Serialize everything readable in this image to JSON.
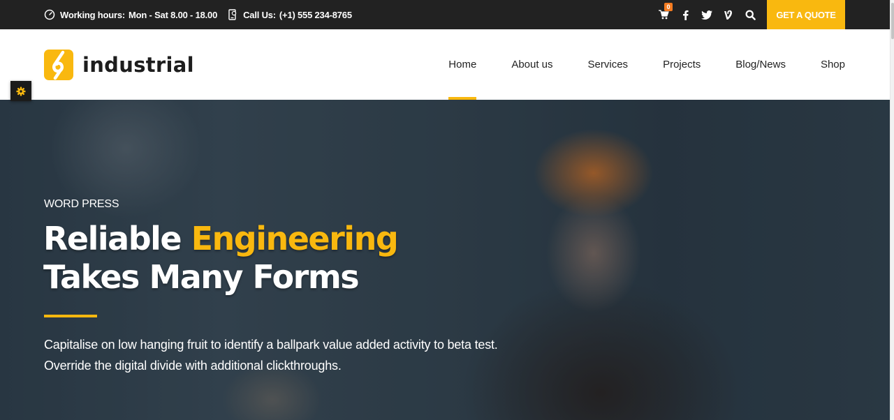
{
  "topbar": {
    "working_hours_label": "Working hours:",
    "working_hours_value": "Mon - Sat 8.00 - 18.00",
    "call_label": "Call Us:",
    "call_value": "(+1) 555 234-8765",
    "cart_count": "0",
    "quote_button": "GET A QUOTE",
    "icons": [
      "clock-icon",
      "phone-icon",
      "cart-icon",
      "facebook-icon",
      "twitter-icon",
      "vine-icon",
      "search-icon"
    ]
  },
  "header": {
    "logo_text": "industrial",
    "nav": [
      {
        "label": "Home",
        "active": true
      },
      {
        "label": "About us",
        "active": false
      },
      {
        "label": "Services",
        "active": false
      },
      {
        "label": "Projects",
        "active": false
      },
      {
        "label": "Blog/News",
        "active": false
      },
      {
        "label": "Shop",
        "active": false
      }
    ]
  },
  "hero": {
    "kicker": "WORD PRESS",
    "title_line1_plain": "Reliable ",
    "title_line1_highlight": "Engineering",
    "title_line2": "Takes Many Forms",
    "description_line1": "Capitalise on low hanging fruit to identify a ballpark value added activity to beta test.",
    "description_line2": "Override the digital divide with additional clickthroughs."
  },
  "colors": {
    "accent": "#f9b80f",
    "topbar_bg": "#222222",
    "badge": "#f47b20"
  }
}
